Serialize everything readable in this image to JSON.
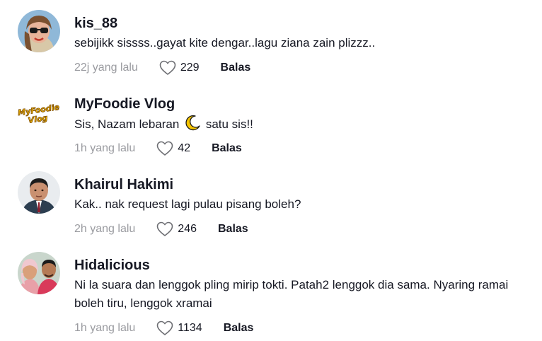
{
  "comments": [
    {
      "username": "kis_88",
      "text": "sebijikk sissss..gayat kite dengar..lagu ziana zain plizzz..",
      "time": "22j yang lalu",
      "likes": "229",
      "reply_label": "Balas",
      "avatar": "avatar-photo-woman-sunglasses"
    },
    {
      "username": "MyFoodie Vlog",
      "text_before": "Sis, Nazam lebaran",
      "text_after": "satu sis!!",
      "emoji": "crescent-moon-emoji",
      "time": "1h yang lalu",
      "likes": "42",
      "reply_label": "Balas",
      "avatar": "avatar-logo-myfoodie-vlog",
      "logo_text": "MyFoodie Vlog"
    },
    {
      "username": "Khairul Hakimi",
      "text": "Kak.. nak request lagi pulau pisang boleh?",
      "time": "2h yang lalu",
      "likes": "246",
      "reply_label": "Balas",
      "avatar": "avatar-photo-man"
    },
    {
      "username": "Hidalicious",
      "text": "Ni la suara dan lenggok pling mirip tokti. Patah2 lenggok dia sama. Nyaring ramai boleh tiru, lenggok xramai",
      "time": "1h yang lalu",
      "likes": "1134",
      "reply_label": "Balas",
      "avatar": "avatar-photo-couple"
    }
  ],
  "icons": {
    "like": "heart-outline-icon"
  },
  "colors": {
    "text": "#161823",
    "muted": "#9a9ba0",
    "background": "#ffffff"
  }
}
